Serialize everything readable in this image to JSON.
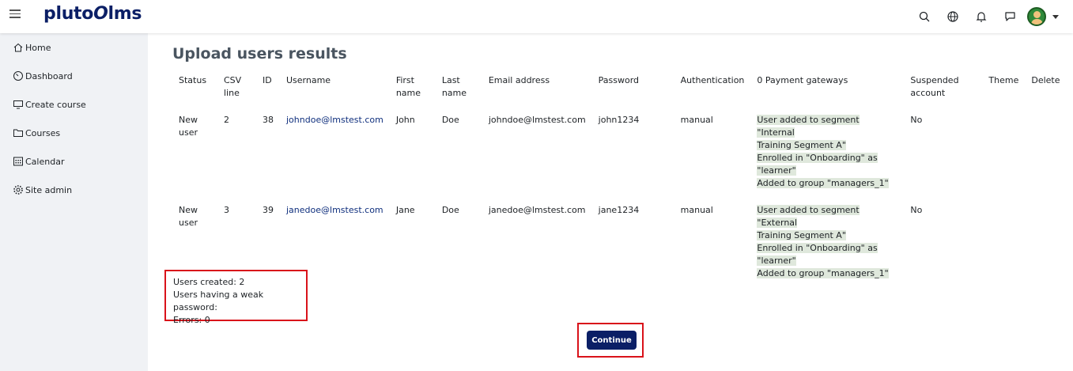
{
  "app": {
    "logo_left": "pluto",
    "logo_mark": "O",
    "logo_right": "lms"
  },
  "topbar": {
    "icons": [
      "search-icon",
      "globe-icon",
      "bell-icon",
      "chat-icon",
      "avatar"
    ]
  },
  "sidebar": {
    "items": [
      {
        "label": "Home",
        "icon": "home-icon"
      },
      {
        "label": "Dashboard",
        "icon": "gauge-icon"
      },
      {
        "label": "Create course",
        "icon": "monitor-icon"
      },
      {
        "label": "Courses",
        "icon": "folder-icon"
      },
      {
        "label": "Calendar",
        "icon": "calendar-icon"
      },
      {
        "label": "Site admin",
        "icon": "gear-icon"
      }
    ]
  },
  "page": {
    "title": "Upload users results"
  },
  "table": {
    "headers": {
      "status": "Status",
      "csv_line_1": "CSV",
      "csv_line_2": "line",
      "id": "ID",
      "username": "Username",
      "first_1": "First",
      "first_2": "name",
      "last_1": "Last",
      "last_2": "name",
      "email": "Email address",
      "password": "Password",
      "auth": "Authentication",
      "payment": "0 Payment gateways",
      "suspended_1": "Suspended",
      "suspended_2": "account",
      "theme": "Theme",
      "delete": "Delete"
    },
    "rows": [
      {
        "status_1": "New",
        "status_2": "user",
        "csv_line": "2",
        "id": "38",
        "username": "johndoe@lmstest.com",
        "first_name": "John",
        "last_name": "Doe",
        "email": "johndoe@lmstest.com",
        "password": "john1234",
        "auth": "manual",
        "payment_lines": [
          "User added to segment \"Internal",
          "Training Segment A\"",
          "Enrolled in \"Onboarding\" as",
          "\"learner\"",
          "Added to group \"managers_1\""
        ],
        "suspended": "No"
      },
      {
        "status_1": "New",
        "status_2": "user",
        "csv_line": "3",
        "id": "39",
        "username": "janedoe@lmstest.com",
        "first_name": "Jane",
        "last_name": "Doe",
        "email": "janedoe@lmstest.com",
        "password": "jane1234",
        "auth": "manual",
        "payment_lines": [
          "User added to segment \"External",
          "Training Segment A\"",
          "Enrolled in \"Onboarding\" as",
          "\"learner\"",
          "Added to group \"managers_1\""
        ],
        "suspended": "No"
      }
    ]
  },
  "summary": {
    "created": "Users created: 2",
    "weak": "Users having a weak password:",
    "errors": "Errors: 0"
  },
  "actions": {
    "continue_label": "Continue"
  },
  "colors": {
    "brand": "#0b1f66",
    "highlight": "#dfe8dc",
    "annotation_border": "#d9121a",
    "sidebar_bg": "#f0f2f5"
  }
}
